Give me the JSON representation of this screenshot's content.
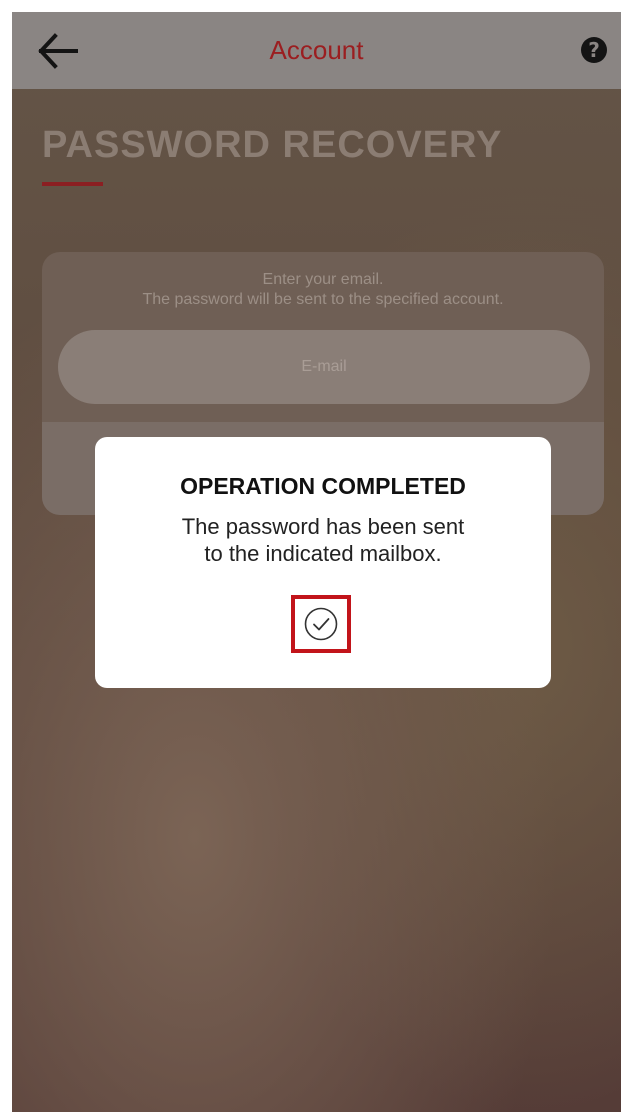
{
  "topbar": {
    "back_icon": "arrow-left-icon",
    "title": "Account",
    "help_icon": "question-circle-icon",
    "help_glyph": "?"
  },
  "page": {
    "title": "PASSWORD RECOVERY"
  },
  "form": {
    "instruction_line1": "Enter your email.",
    "instruction_line2": "The password will be sent to the specified account.",
    "email_placeholder": "E-mail",
    "email_value": ""
  },
  "dialog": {
    "title": "OPERATION COMPLETED",
    "message_line1": "The password has been sent",
    "message_line2": "to the indicated mailbox.",
    "confirm_icon": "check-circle-icon"
  },
  "colors": {
    "accent": "#9b1e20",
    "highlight_border": "#c2141a",
    "topbar_bg": "#8a8583"
  }
}
